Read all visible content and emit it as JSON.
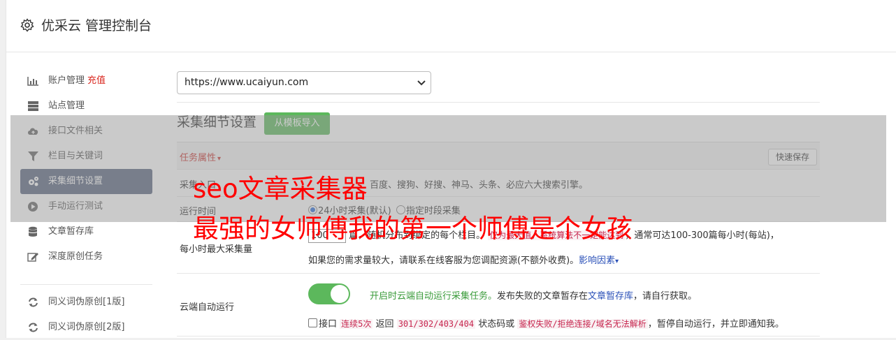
{
  "header": {
    "title": "优采云 管理控制台",
    "icon": "gear-icon"
  },
  "sidebar": {
    "items": [
      {
        "label": "账户管理",
        "extra": "充值",
        "icon": "bar-chart-icon"
      },
      {
        "label": "站点管理",
        "icon": "server-icon"
      },
      {
        "label": "接口文件相关",
        "icon": "cloud-upload-icon"
      },
      {
        "label": "栏目与关键词",
        "icon": "filter-icon"
      },
      {
        "label": "采集细节设置",
        "icon": "cogs-icon",
        "active": true
      },
      {
        "label": "手动运行测试",
        "icon": "play-circle-icon"
      },
      {
        "label": "文章暂存库",
        "icon": "database-icon"
      },
      {
        "label": "深度原创任务",
        "icon": "edit-icon"
      }
    ],
    "items2": [
      {
        "label": "同义词伪原创[1版]",
        "icon": "refresh-icon"
      },
      {
        "label": "同义词伪原创[2版]",
        "icon": "refresh-icon"
      }
    ]
  },
  "site_select": {
    "value": "https://www.ucaiyun.com"
  },
  "section": {
    "title": "采集细节设置",
    "template_button": "从模板导入"
  },
  "table": {
    "task_attr": "任务属性",
    "quick_save": "快速保存",
    "row1": {
      "label": "采集入口",
      "text": "百度、搜狗、好搜、神马、头条、必应六大搜索引擎。"
    },
    "row2": {
      "label": "运行时间",
      "opt1": "24小时采集(默认)",
      "opt2": "指定时段采集"
    },
    "row3": {
      "label": "每小时最大采集量",
      "input_value": "100",
      "text_a": "篇，随机分布到绑定的每个栏目。",
      "text_b": "仅为最大值，系统算法不一定能达到",
      "text_c": "，通常可达100-300篇每小时(每站)，",
      "line2": "如果您的需求量较大，请联系在线客服为您调配资源(不额外收费)。",
      "link": "影响因素"
    },
    "row4": {
      "label": "云端自动运行",
      "toggle_on": true,
      "line1_a": "开启时云端自动运行采集任务。",
      "line1_b": "发布失败的文章暂存在",
      "line1_link": "文章暂存库",
      "line1_c": "，请自行获取。",
      "check_label": "接口",
      "code1": "连续5次",
      "t1": "返回",
      "code2": "301/302/403/404",
      "t2": "状态码或",
      "code3": "鉴权失败/拒绝连接/域名无法解析",
      "t3": "，暂停自动运行，并立即通知我。"
    }
  },
  "overlay": {
    "line1": "seo文章采集器",
    "line2": "最强的女师傅我的第一个师傅是个女孩"
  },
  "colors": {
    "accent_green": "#5cb85c",
    "active_nav": "#5a6680",
    "red": "#ff0000"
  }
}
